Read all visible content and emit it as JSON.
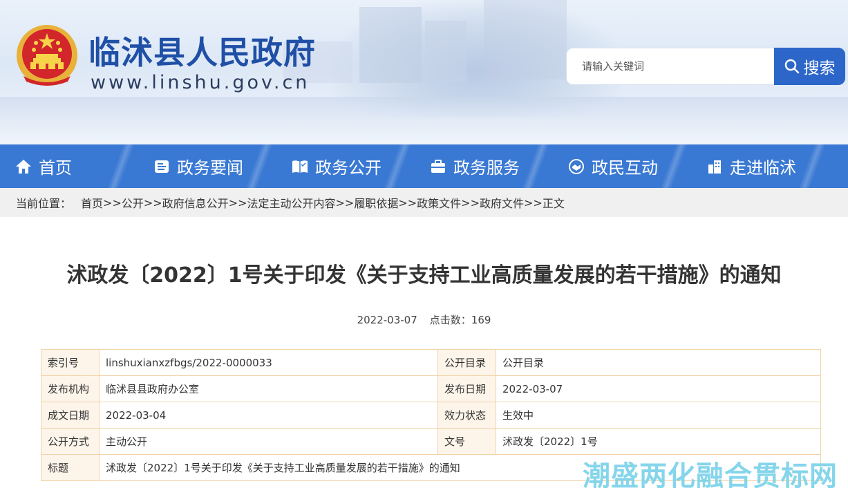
{
  "header": {
    "site_title": "临沭县人民政府",
    "site_url": "www.linshu.gov.cn",
    "search_placeholder": "请输入关键词",
    "search_button": "搜索"
  },
  "nav": [
    {
      "label": "首页",
      "icon": "home-icon"
    },
    {
      "label": "政务要闻",
      "icon": "news-icon"
    },
    {
      "label": "政务公开",
      "icon": "open-book-icon"
    },
    {
      "label": "政务服务",
      "icon": "briefcase-icon"
    },
    {
      "label": "政民互动",
      "icon": "handshake-icon"
    },
    {
      "label": "走进临沭",
      "icon": "building-icon"
    }
  ],
  "breadcrumb": {
    "label": "当前位置：",
    "items": [
      "首页",
      "公开",
      "政府信息公开",
      "法定主动公开内容",
      "履职依据",
      "政策文件",
      "政府文件",
      "正文"
    ],
    "separator": ">>"
  },
  "article": {
    "title": "沭政发〔2022〕1号关于印发《关于支持工业高质量发展的若干措施》的通知",
    "date": "2022-03-07",
    "clicks_label": "点击数：",
    "clicks": "169"
  },
  "info_table": {
    "rows": [
      {
        "k1": "索引号",
        "v1": "linshuxianxzfbgs/2022-0000033",
        "k2": "公开目录",
        "v2": "公开目录"
      },
      {
        "k1": "发布机构",
        "v1": "临沭县县政府办公室",
        "k2": "发布日期",
        "v2": "2022-03-07"
      },
      {
        "k1": "成文日期",
        "v1": "2022-03-04",
        "k2": "效力状态",
        "v2": "生效中"
      },
      {
        "k1": "公开方式",
        "v1": "主动公开",
        "k2": "文号",
        "v2": "沭政发〔2022〕1号"
      }
    ],
    "title_row": {
      "k": "标题",
      "v": "沭政发〔2022〕1号关于印发《关于支持工业高质量发展的若干措施》的通知"
    }
  },
  "watermark": "潮盛两化融合贯标网",
  "colors": {
    "brand_blue": "#1f4fa6",
    "nav_blue": "#3a79d3",
    "search_blue": "#2c66c9",
    "table_border": "#f0d3a8",
    "table_key_bg": "#fdf5ea",
    "watermark": "#7fd3ea"
  }
}
